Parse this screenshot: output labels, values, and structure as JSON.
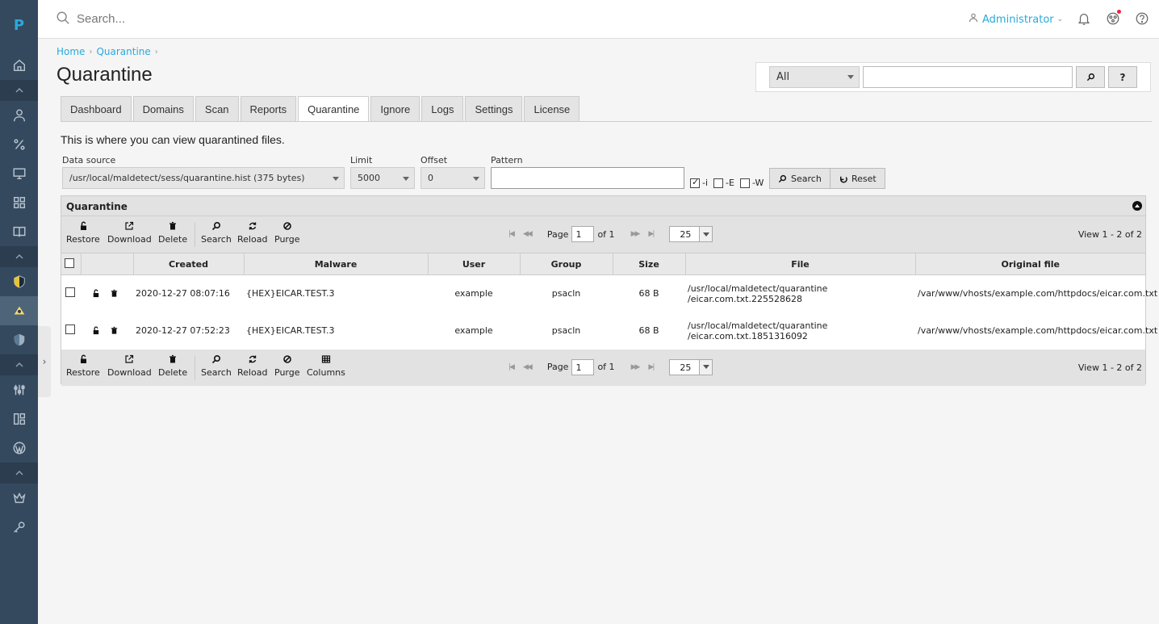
{
  "rail": {
    "logo": "P"
  },
  "topbar": {
    "search_placeholder": "Search...",
    "user": "Administrator"
  },
  "breadcrumb": {
    "home": "Home",
    "current": "Quarantine"
  },
  "page_title": "Quarantine",
  "global_search": {
    "scope": "All",
    "help": "?"
  },
  "tabs": [
    {
      "label": "Dashboard"
    },
    {
      "label": "Domains"
    },
    {
      "label": "Scan"
    },
    {
      "label": "Reports"
    },
    {
      "label": "Quarantine"
    },
    {
      "label": "Ignore"
    },
    {
      "label": "Logs"
    },
    {
      "label": "Settings"
    },
    {
      "label": "License"
    }
  ],
  "active_tab": "Quarantine",
  "intro": "This is where you can view quarantined files.",
  "filters": {
    "data_source_label": "Data source",
    "data_source_value": "/usr/local/maldetect/sess/quarantine.hist (375 bytes)",
    "limit_label": "Limit",
    "limit_value": "5000",
    "offset_label": "Offset",
    "offset_value": "0",
    "pattern_label": "Pattern",
    "flag_i": "-i",
    "flag_e": "-E",
    "flag_w": "-W",
    "search_btn": "Search",
    "reset_btn": "Reset"
  },
  "grid": {
    "title": "Quarantine",
    "toolbar": {
      "restore": "Restore",
      "download": "Download",
      "delete": "Delete",
      "search": "Search",
      "reload": "Reload",
      "purge": "Purge",
      "columns": "Columns"
    },
    "pager": {
      "page_label": "Page",
      "page": "1",
      "of": "of 1",
      "page_size": "25",
      "view_info": "View 1 - 2 of 2"
    },
    "columns": [
      "Created",
      "Malware",
      "User",
      "Group",
      "Size",
      "File",
      "Original file"
    ],
    "rows": [
      {
        "created": "2020-12-27 08:07:16",
        "malware": "{HEX}EICAR.TEST.3",
        "user": "example",
        "group": "psacln",
        "size": "68 B",
        "file_line1": "/usr/local/maldetect/quarantine",
        "file_line2": "/eicar.com.txt.225528628",
        "original": "/var/www/vhosts/example.com/httpdocs/eicar.com.txt"
      },
      {
        "created": "2020-12-27 07:52:23",
        "malware": "{HEX}EICAR.TEST.3",
        "user": "example",
        "group": "psacln",
        "size": "68 B",
        "file_line1": "/usr/local/maldetect/quarantine",
        "file_line2": "/eicar.com.txt.1851316092",
        "original": "/var/www/vhosts/example.com/httpdocs/eicar.com.txt"
      }
    ]
  }
}
